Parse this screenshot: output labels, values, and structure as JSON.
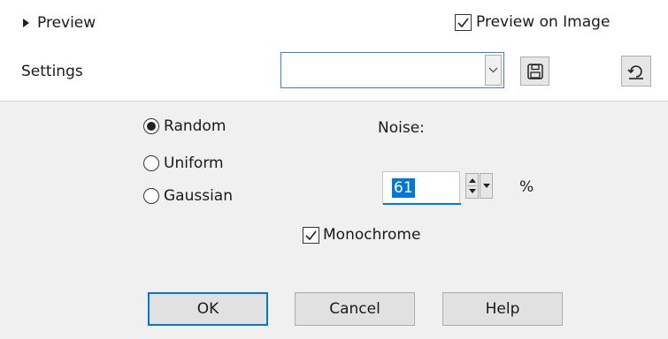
{
  "top": {
    "preview_label": "Preview",
    "preview_on_image_label": "Preview on Image",
    "preview_on_image_checked": true
  },
  "settings": {
    "label": "Settings",
    "selected_value": ""
  },
  "distribution": {
    "options": [
      "Random",
      "Uniform",
      "Gaussian"
    ],
    "selected": "Random"
  },
  "noise": {
    "label": "Noise:",
    "value": "61",
    "unit": "%"
  },
  "monochrome": {
    "label": "Monochrome",
    "checked": true
  },
  "buttons": {
    "ok": "OK",
    "cancel": "Cancel",
    "help": "Help"
  },
  "colors": {
    "accent": "#0078d7",
    "panel_bg": "#f0f0f0",
    "button_bg": "#e1e1e1"
  },
  "icons": {
    "save": "floppy-disk-icon",
    "reset": "reset-icon",
    "dropdown": "chevron-down-icon"
  }
}
